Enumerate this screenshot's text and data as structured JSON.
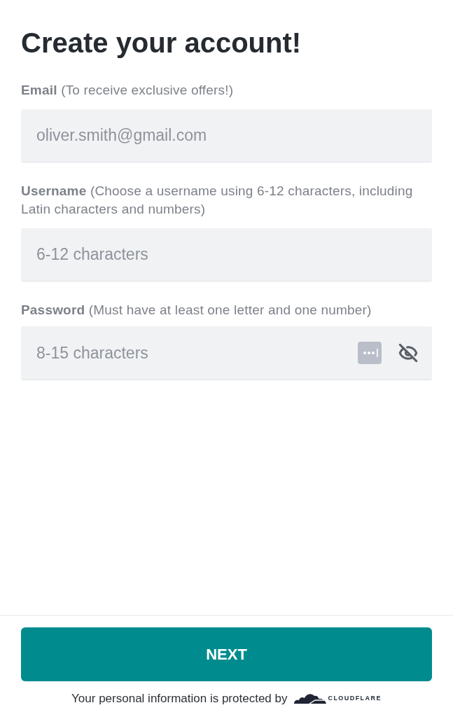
{
  "title": "Create your account!",
  "fields": [
    {
      "kind": "text",
      "label": "**Email** (To receive exclusive offers!)",
      "placeholder": "oliver.smith@gmail.com"
    },
    {
      "kind": "text",
      "label": "**Username** (Choose a username using 6-12 characters, including Latin characters and numbers)",
      "placeholder": "6-12 characters"
    },
    {
      "kind": "password",
      "label": "**Password** (Must have at least one letter and one number)",
      "placeholder": "8-15 characters",
      "show_password": false
    }
  ],
  "next_button": "NEXT",
  "footer": {
    "text": "Your personal information is protected by",
    "logo_text": "CLOUDFLARE"
  }
}
